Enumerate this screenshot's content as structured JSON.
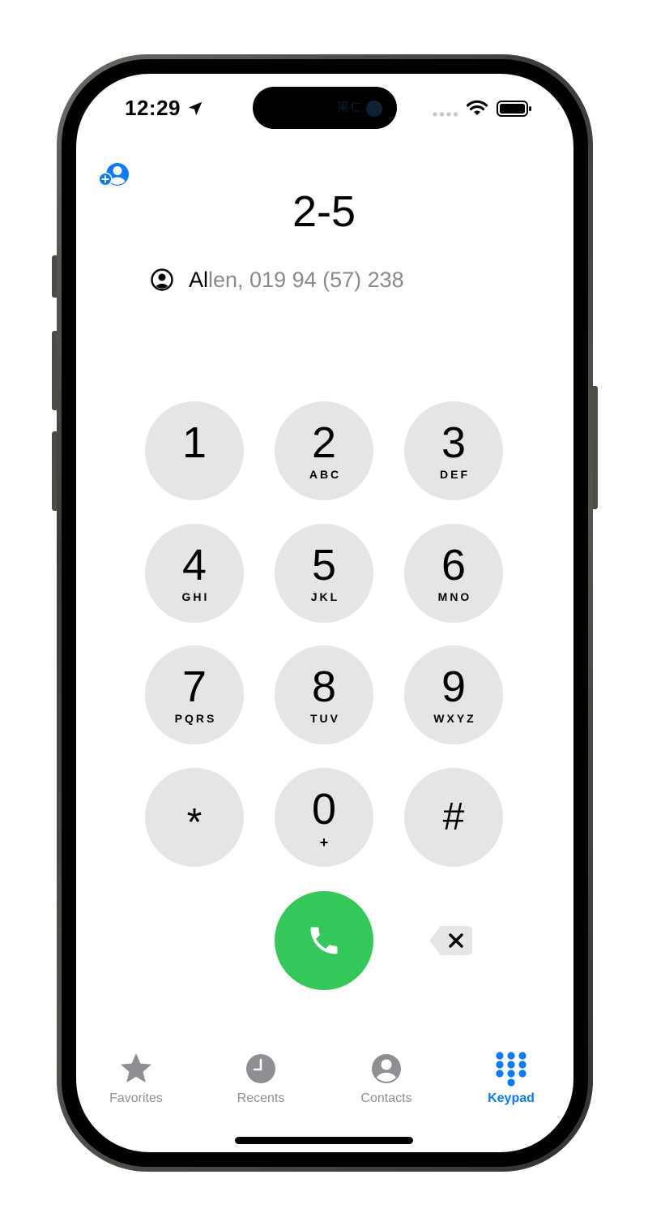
{
  "status_bar": {
    "time": "12:29",
    "island_text": "果仁"
  },
  "dialer": {
    "number": "2-5",
    "suggestion": {
      "match": "Al",
      "rest": "len, 019 94 (57) 238"
    }
  },
  "keypad": {
    "keys": [
      {
        "digit": "1",
        "letters": ""
      },
      {
        "digit": "2",
        "letters": "ABC"
      },
      {
        "digit": "3",
        "letters": "DEF"
      },
      {
        "digit": "4",
        "letters": "GHI"
      },
      {
        "digit": "5",
        "letters": "JKL"
      },
      {
        "digit": "6",
        "letters": "MNO"
      },
      {
        "digit": "7",
        "letters": "PQRS"
      },
      {
        "digit": "8",
        "letters": "TUV"
      },
      {
        "digit": "9",
        "letters": "WXYZ"
      },
      {
        "digit": "*",
        "letters": ""
      },
      {
        "digit": "0",
        "letters": "+"
      },
      {
        "digit": "#",
        "letters": ""
      }
    ]
  },
  "tabbar": {
    "tabs": [
      {
        "label": "Favorites",
        "icon": "star-icon",
        "active": false
      },
      {
        "label": "Recents",
        "icon": "clock-icon",
        "active": false
      },
      {
        "label": "Contacts",
        "icon": "person-circle-icon",
        "active": false
      },
      {
        "label": "Keypad",
        "icon": "keypad-grid-icon",
        "active": true
      }
    ]
  },
  "colors": {
    "accent": "#0a7aff",
    "call_green": "#34c759",
    "key_gray": "#e5e5e5",
    "inactive_gray": "#8e8e93"
  }
}
